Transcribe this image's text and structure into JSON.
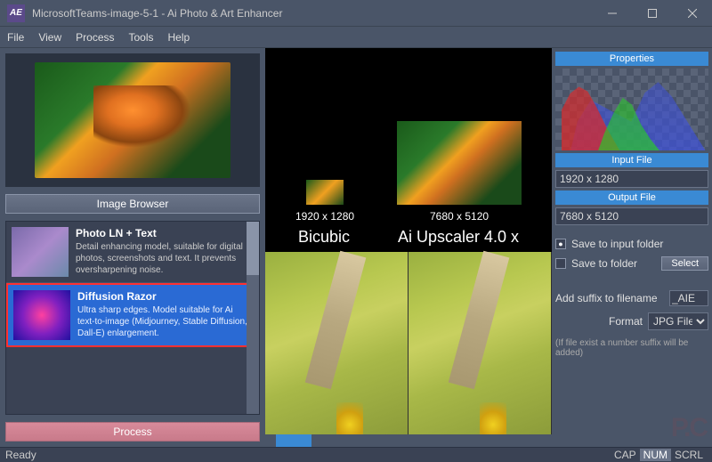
{
  "window": {
    "title": "MicrosoftTeams-image-5-1 - Ai Photo & Art Enhancer",
    "app_icon": "AE"
  },
  "menu": [
    "File",
    "View",
    "Process",
    "Tools",
    "Help"
  ],
  "left": {
    "image_browser": "Image Browser",
    "models": [
      {
        "title": "Photo LN + Text",
        "desc": "Detail enhancing model, suitable for digital photos, screenshots and text. It prevents oversharpening noise."
      },
      {
        "title": "Diffusion Razor",
        "desc": "Ultra sharp edges. Model suitable for Ai text-to-image (Midjourney, Stable Diffusion, Dall-E) enlargement."
      }
    ],
    "process": "Process"
  },
  "center": {
    "left_dim": "1920 x 1280",
    "right_dim": "7680 x 5120",
    "left_title": "Bicubic",
    "right_title": "Ai Upscaler 4.0 x"
  },
  "right": {
    "properties": "Properties",
    "input_file_hdr": "Input File",
    "input_file_val": "1920 x 1280",
    "output_file_hdr": "Output File",
    "output_file_val": "7680 x 5120",
    "save_input": "Save to input folder",
    "save_folder": "Save to folder",
    "select": "Select",
    "suffix_label": "Add suffix to filename",
    "suffix_val": "_AIE",
    "format_label": "Format",
    "format_val": "JPG File",
    "hint": "(If file exist a number suffix will be added)"
  },
  "status": {
    "ready": "Ready",
    "cap": "CAP",
    "num": "NUM",
    "scrl": "SCRL"
  }
}
